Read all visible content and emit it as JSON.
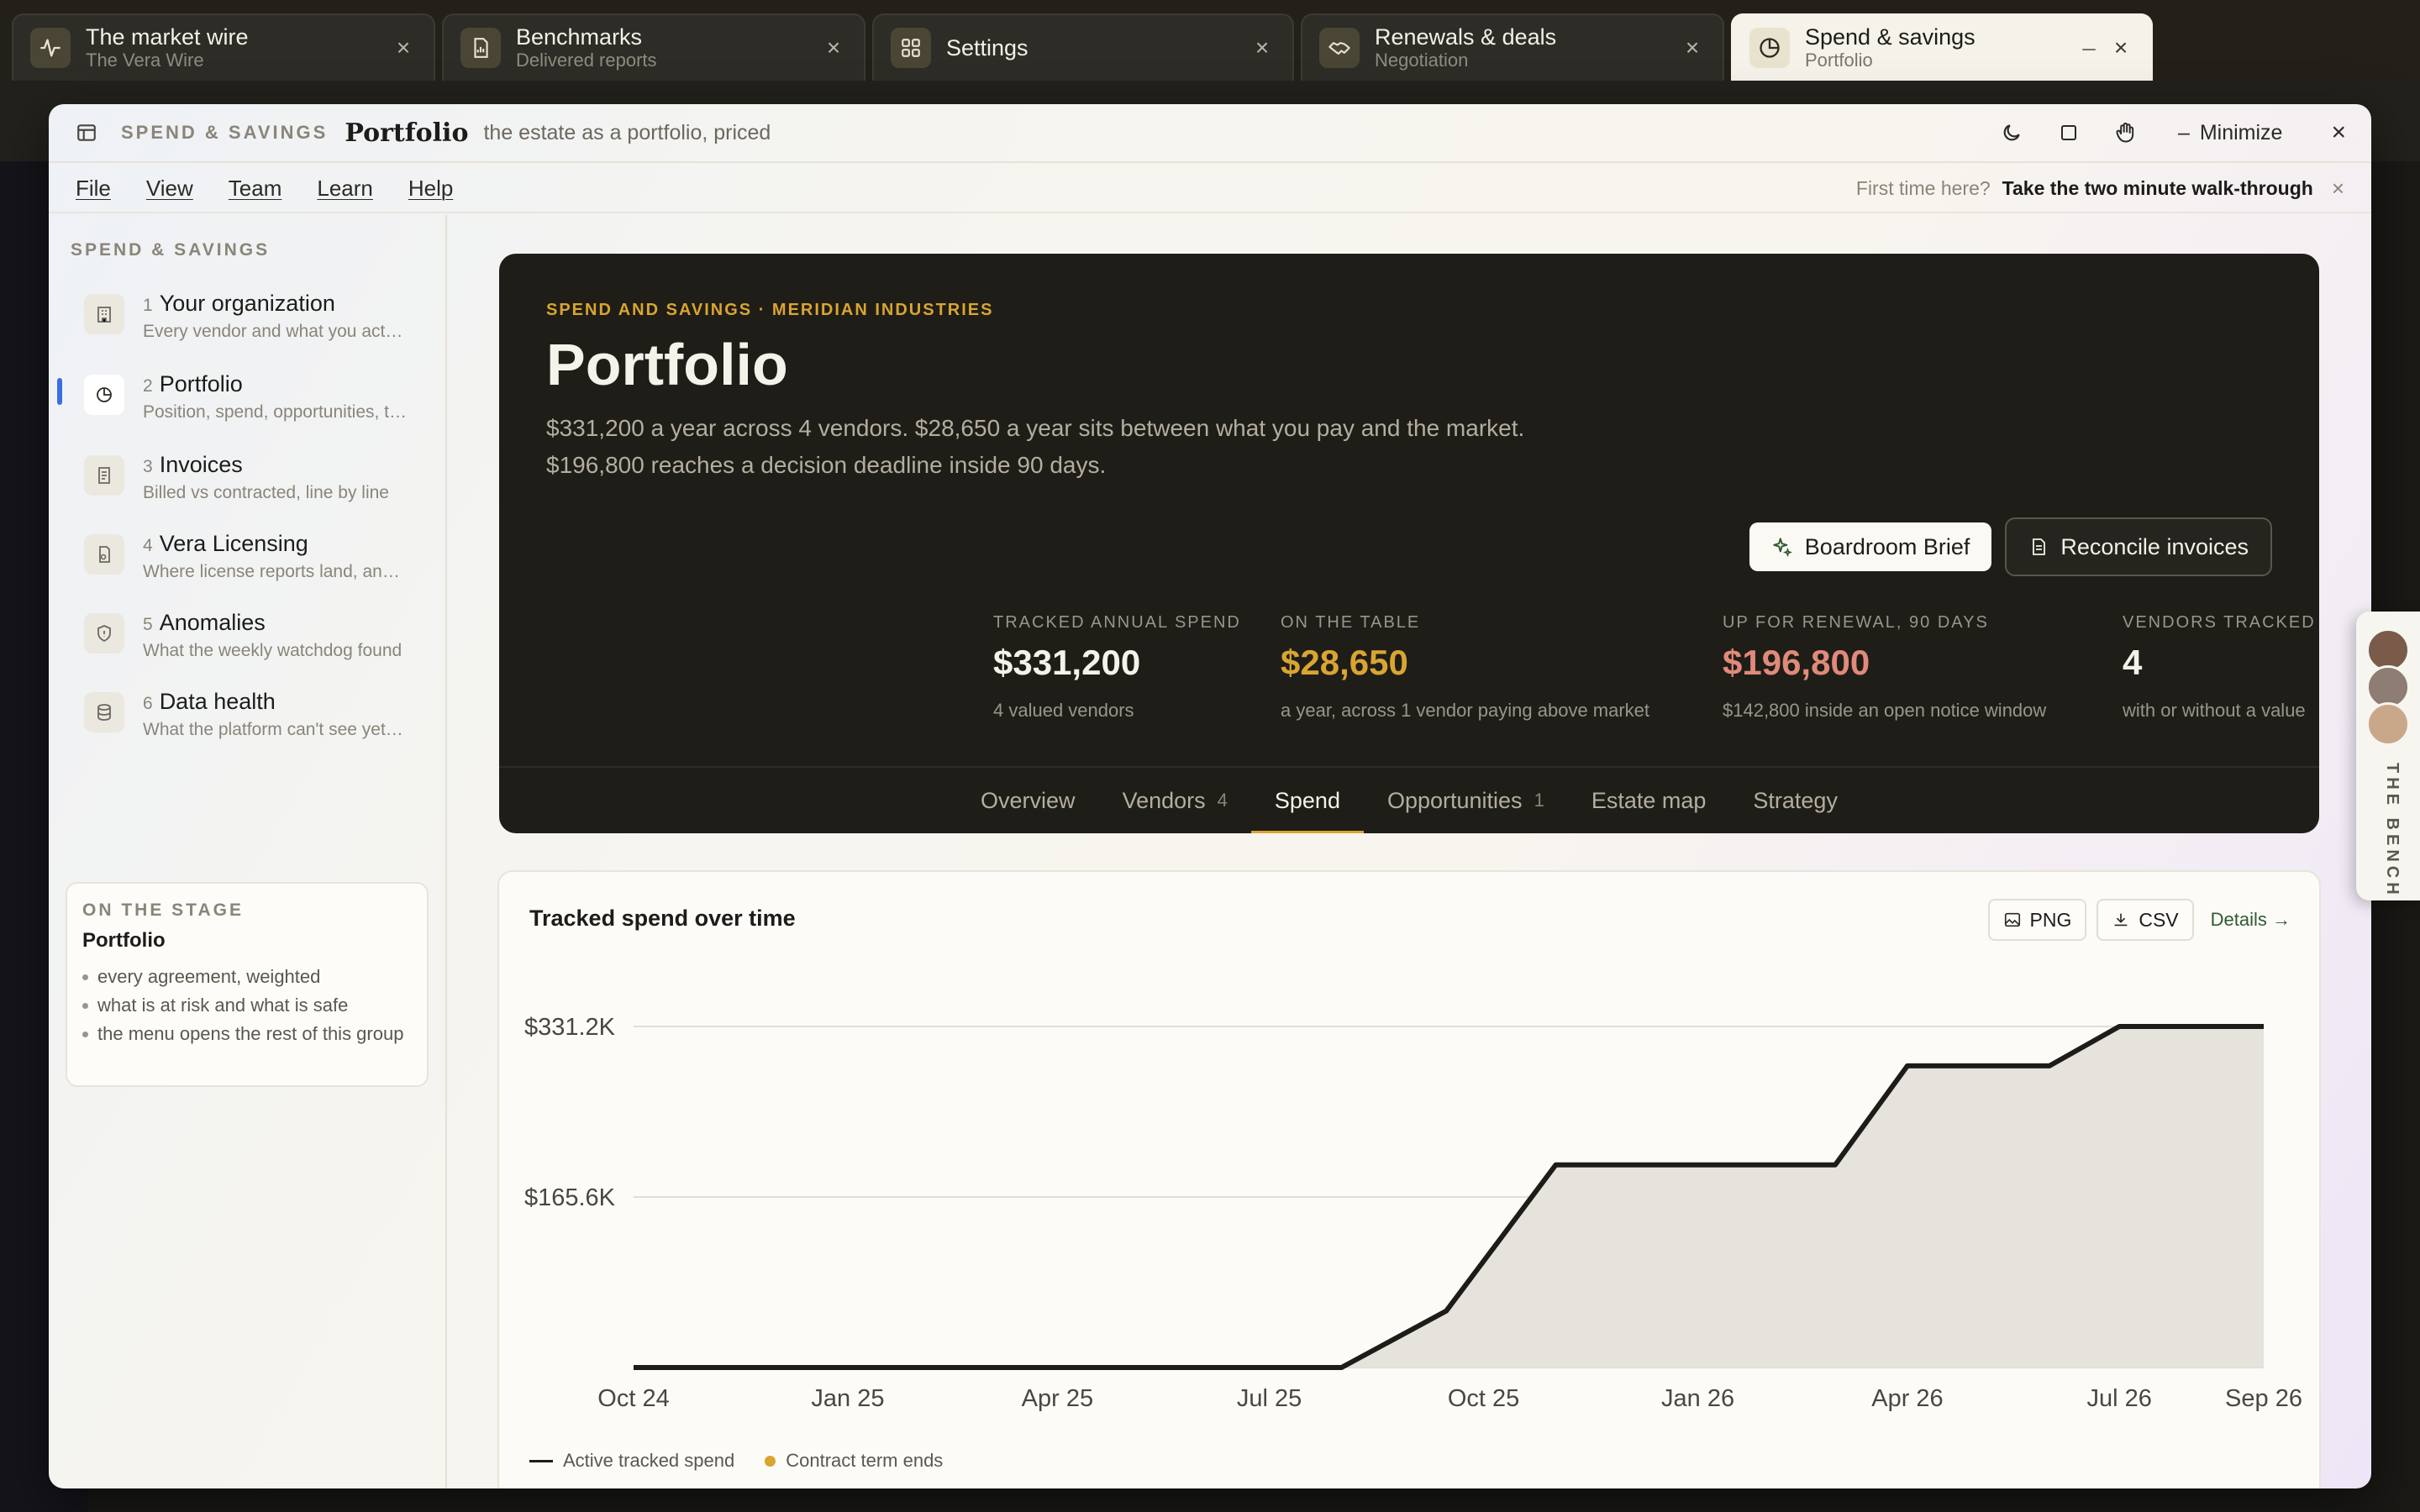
{
  "tabs": [
    {
      "title": "The market wire",
      "subtitle": "The Vera Wire",
      "icon": "pulse-icon"
    },
    {
      "title": "Benchmarks",
      "subtitle": "Delivered reports",
      "icon": "document-chart-icon"
    },
    {
      "title": "Settings",
      "subtitle": "",
      "icon": "grid-icon"
    },
    {
      "title": "Renewals & deals",
      "subtitle": "Negotiation",
      "icon": "handshake-icon"
    },
    {
      "title": "Spend & savings",
      "subtitle": "Portfolio",
      "icon": "pie-chart-icon"
    }
  ],
  "window": {
    "kicker": "SPEND & SAVINGS",
    "title": "Portfolio",
    "description": "the estate as a portfolio, priced",
    "minimize_label": "Minimize"
  },
  "menu": {
    "items": [
      "File",
      "View",
      "Team",
      "Learn",
      "Help"
    ],
    "hint": "First time here?",
    "walkthrough": "Take the two minute walk-through"
  },
  "sidebar": {
    "heading": "SPEND & SAVINGS",
    "items": [
      {
        "num": "1",
        "title": "Your organization",
        "desc": "Every vendor and what you act…",
        "icon": "building-icon"
      },
      {
        "num": "2",
        "title": "Portfolio",
        "desc": "Position, spend, opportunities, t…",
        "icon": "pie-chart-icon"
      },
      {
        "num": "3",
        "title": "Invoices",
        "desc": "Billed vs contracted, line by line",
        "icon": "receipt-icon"
      },
      {
        "num": "4",
        "title": "Vera Licensing",
        "desc": "Where license reports land, an…",
        "icon": "license-icon"
      },
      {
        "num": "5",
        "title": "Anomalies",
        "desc": "What the weekly watchdog found",
        "icon": "shield-icon"
      },
      {
        "num": "6",
        "title": "Data health",
        "desc": "What the platform can't see yet…",
        "icon": "database-icon"
      }
    ],
    "active_index": 1,
    "stage": {
      "kicker": "ON THE STAGE",
      "title": "Portfolio",
      "bullets": [
        "every agreement, weighted",
        "what is at risk and what is safe",
        "the menu opens the rest of this group"
      ]
    }
  },
  "hero": {
    "kicker": "SPEND AND SAVINGS · MERIDIAN INDUSTRIES",
    "title": "Portfolio",
    "summary": "$331,200 a year across 4 vendors. $28,650 a year sits between what you pay and the market. $196,800 reaches a decision deadline inside 90 days.",
    "brief_button": "Boardroom Brief",
    "reconcile_button": "Reconcile invoices",
    "stats": [
      {
        "label": "TRACKED ANNUAL SPEND",
        "value": "$331,200",
        "sub": "4 valued vendors",
        "color": "#f5f2ea"
      },
      {
        "label": "ON THE TABLE",
        "value": "$28,650",
        "sub": "a year, across 1 vendor paying above market",
        "color": "#d9a531"
      },
      {
        "label": "UP FOR RENEWAL, 90 DAYS",
        "value": "$196,800",
        "sub": "$142,800 inside an open notice window",
        "color": "#e08a7a"
      },
      {
        "label": "VENDORS TRACKED",
        "value": "4",
        "sub": "with or without a value",
        "color": "#f5f2ea"
      }
    ],
    "tabs": [
      {
        "label": "Overview",
        "count": ""
      },
      {
        "label": "Vendors",
        "count": "4"
      },
      {
        "label": "Spend",
        "count": ""
      },
      {
        "label": "Opportunities",
        "count": "1"
      },
      {
        "label": "Estate map",
        "count": ""
      },
      {
        "label": "Strategy",
        "count": ""
      }
    ],
    "active_tab": 2
  },
  "chart_panel": {
    "title": "Tracked spend over time",
    "png_label": "PNG",
    "csv_label": "CSV",
    "details_label": "Details →",
    "legend_line": "Active tracked spend",
    "legend_dot": "Contract term ends"
  },
  "chart_data": {
    "type": "area",
    "title": "Tracked spend over time",
    "xlabel": "",
    "ylabel": "",
    "x_ticks": [
      "Oct 24",
      "Jan 25",
      "Apr 25",
      "Jul 25",
      "Oct 25",
      "Jan 26",
      "Apr 26",
      "Jul 26",
      "Sep 26"
    ],
    "y_ticks": [
      "$331.2K",
      "$165.6K"
    ],
    "ylim": [
      0,
      331200
    ],
    "xlim_months": [
      "2024-10",
      "2026-09"
    ],
    "grid": true,
    "legend": "bottom-left",
    "series": [
      {
        "name": "Active tracked spend",
        "points": [
          {
            "x": "2024-10-01",
            "y": 0
          },
          {
            "x": "2025-08-01",
            "y": 0
          },
          {
            "x": "2025-09-15",
            "y": 55000
          },
          {
            "x": "2025-11-01",
            "y": 196800
          },
          {
            "x": "2026-03-01",
            "y": 196800
          },
          {
            "x": "2026-04-01",
            "y": 293000
          },
          {
            "x": "2026-06-01",
            "y": 293000
          },
          {
            "x": "2026-07-01",
            "y": 331200
          },
          {
            "x": "2026-09-01",
            "y": 331200
          }
        ]
      }
    ],
    "colors": {
      "line": "#1d1c19",
      "area": "#e6e3dc",
      "grid": "#e2ded4",
      "marker": "#d9a531"
    }
  },
  "bench": {
    "label": "THE BENCH"
  },
  "colors": {
    "accent_gold": "#d9a531",
    "accent_red": "#e08a7a",
    "active_bar": "#3b6fe0"
  }
}
